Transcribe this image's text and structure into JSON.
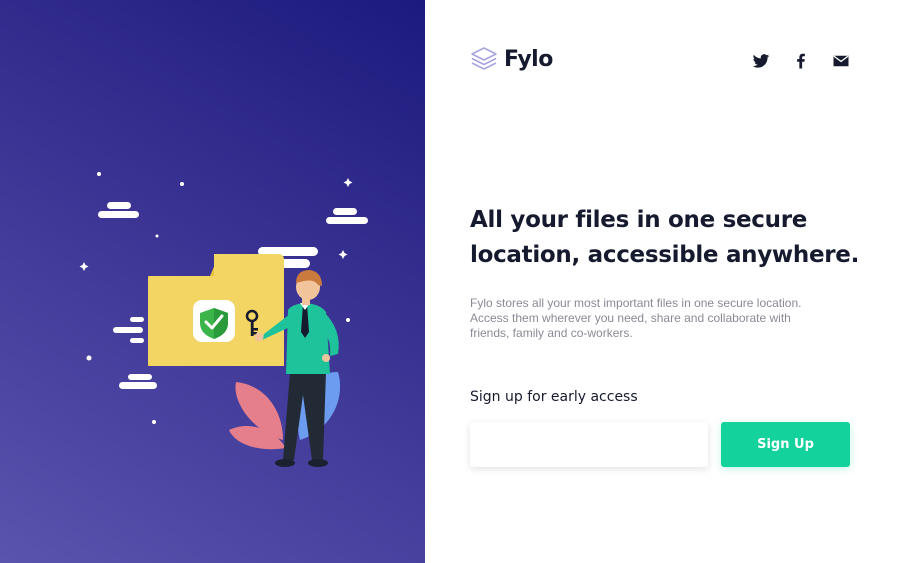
{
  "brand": {
    "name": "Fylo",
    "logo_icon": "stacked-layers-icon",
    "accent_color": "#14d29c",
    "text_color": "#161a2e",
    "panel_gradient": [
      "#1c1a7e",
      "#5a54ae"
    ]
  },
  "social": [
    {
      "icon": "twitter-icon"
    },
    {
      "icon": "facebook-icon"
    },
    {
      "icon": "email-icon"
    }
  ],
  "hero": {
    "headline_line1": "All your files in one secure",
    "headline_line2": "location, accessible anywhere.",
    "description": "Fylo stores all your most important files in one secure location. Access them wherever you need, share and collaborate with friends, family and co-workers."
  },
  "signup": {
    "label": "Sign up for early access",
    "email_value": "",
    "email_placeholder": "",
    "button_label": "Sign Up"
  },
  "illustration": {
    "description_icons": [
      "folder-icon",
      "shield-check-icon",
      "key-icon",
      "person-figure",
      "cloud-icon",
      "plant-leaves"
    ]
  }
}
